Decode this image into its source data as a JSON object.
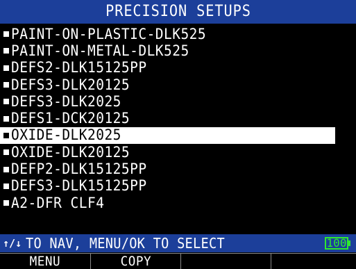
{
  "header": {
    "title": "PRECISION SETUPS"
  },
  "setups": {
    "items": [
      {
        "label": "PAINT-ON-PLASTIC-DLK525",
        "selected": false
      },
      {
        "label": "PAINT-ON-METAL-DLK525",
        "selected": false
      },
      {
        "label": "DEFS2-DLK15125PP",
        "selected": false
      },
      {
        "label": "DEFS3-DLK20125",
        "selected": false
      },
      {
        "label": "DEFS3-DLK2025",
        "selected": false
      },
      {
        "label": "DEFS1-DCK20125",
        "selected": false
      },
      {
        "label": "OXIDE-DLK2025",
        "selected": true
      },
      {
        "label": "OXIDE-DLK20125",
        "selected": false
      },
      {
        "label": "DEFP2-DLK15125PP",
        "selected": false
      },
      {
        "label": "DEFS3-DLK15125PP",
        "selected": false
      },
      {
        "label": "A2-DFR CLF4",
        "selected": false
      }
    ]
  },
  "status": {
    "nav_hint": "TO NAV, MENU/OK TO SELECT",
    "battery_level": "100"
  },
  "softkeys": {
    "key1": "MENU",
    "key2": "COPY",
    "key3": "",
    "key4": ""
  },
  "icons": {
    "nav_arrows": "up-down-arrows-icon",
    "bullet": "square-bullet-icon",
    "battery": "battery-icon"
  },
  "colors": {
    "title_bar": "#1c3f9a",
    "status_bar": "#1c3f9a",
    "background": "#000000",
    "text": "#ffffff",
    "selection": "#ffffff",
    "battery": "#2ee82e"
  }
}
